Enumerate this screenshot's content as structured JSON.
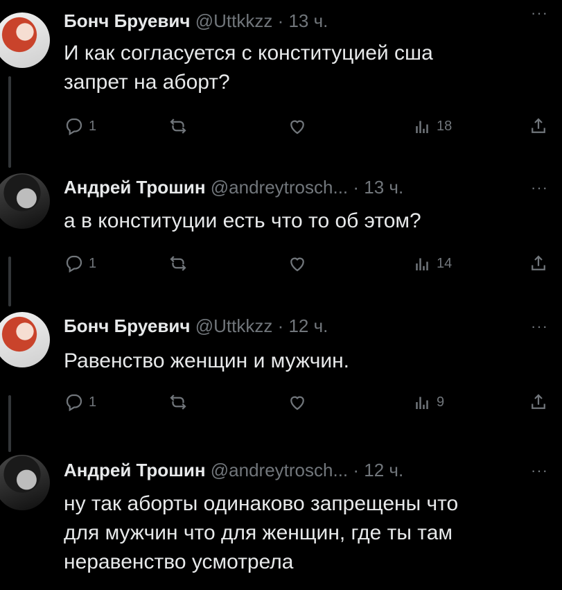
{
  "tweets": [
    {
      "name": "Бонч Бруевич",
      "handle": "@Uttkkzz",
      "time": "· 13 ч.",
      "more": "···",
      "text": "И как согласуется с конституцией сша\nзапрет на аборт?",
      "replies": "1",
      "retweets": "",
      "likes": "",
      "views": "18",
      "avatar": "bonch"
    },
    {
      "name": "Андрей Трошин",
      "handle": "@andreytrosch...",
      "time": "· 13 ч.",
      "more": "···",
      "text": "а в конституции есть что то об этом?",
      "replies": "1",
      "retweets": "",
      "likes": "",
      "views": "14",
      "avatar": "andrey"
    },
    {
      "name": "Бонч Бруевич",
      "handle": "@Uttkkzz",
      "time": "· 12 ч.",
      "more": "···",
      "text": "Равенство женщин и мужчин.",
      "replies": "1",
      "retweets": "",
      "likes": "",
      "views": "9",
      "avatar": "bonch"
    },
    {
      "name": "Андрей Трошин",
      "handle": "@andreytrosch...",
      "time": "· 12 ч.",
      "more": "···",
      "text": "ну так аборты одинаково запрещены что\nдля мужчин что для женщин, где ты там\nнеравенство усмотрела",
      "avatar": "andrey"
    }
  ],
  "icons": {
    "reply": "reply-icon",
    "retweet": "retweet-icon",
    "like": "heart-icon",
    "views": "views-icon",
    "share": "share-icon",
    "more": "more-icon"
  }
}
